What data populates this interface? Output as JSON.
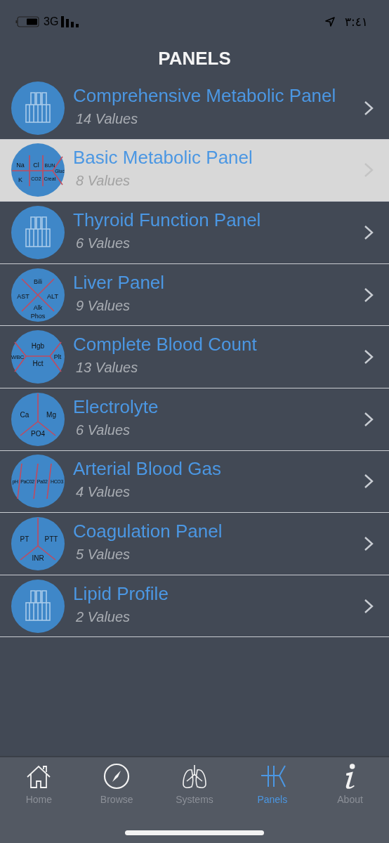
{
  "status_bar": {
    "network": "3G",
    "time": "٣:٤١"
  },
  "title": "PANELS",
  "panels": [
    {
      "name": "Comprehensive Metabolic Panel",
      "count": "14 Values",
      "selected": false,
      "icon": {
        "kind": "tubes"
      }
    },
    {
      "name": "Basic Metabolic Panel",
      "count": "8 Values",
      "selected": true,
      "icon": {
        "kind": "chem7",
        "labels": [
          "Na",
          "Cl",
          "BUN",
          "Gluc",
          "K",
          "CO2",
          "Creat"
        ]
      }
    },
    {
      "name": "Thyroid Function Panel",
      "count": "6 Values",
      "selected": false,
      "icon": {
        "kind": "tubes"
      }
    },
    {
      "name": "Liver Panel",
      "count": "9 Values",
      "selected": false,
      "icon": {
        "kind": "cross",
        "labels": [
          "Bili",
          "AST",
          "ALT",
          "Alk",
          "Phos"
        ]
      }
    },
    {
      "name": "Complete Blood Count",
      "count": "13 Values",
      "selected": false,
      "icon": {
        "kind": "fishbone",
        "labels": [
          "Hgb",
          "WBC",
          "Hct",
          "Plt"
        ]
      }
    },
    {
      "name": "Electrolyte",
      "count": "6 Values",
      "selected": false,
      "icon": {
        "kind": "fork",
        "labels": [
          "Ca",
          "Mg",
          "PO4"
        ]
      }
    },
    {
      "name": "Arterial Blood Gas",
      "count": "4 Values",
      "selected": false,
      "icon": {
        "kind": "slashes",
        "labels": [
          "pH",
          "PaC02",
          "Pa02",
          "HCO3"
        ]
      }
    },
    {
      "name": "Coagulation Panel",
      "count": "5 Values",
      "selected": false,
      "icon": {
        "kind": "fork",
        "labels": [
          "PT",
          "PTT",
          "INR"
        ]
      }
    },
    {
      "name": "Lipid Profile",
      "count": "2 Values",
      "selected": false,
      "icon": {
        "kind": "tubes"
      }
    }
  ],
  "tabs": [
    {
      "label": "Home",
      "selected": false
    },
    {
      "label": "Browse",
      "selected": false
    },
    {
      "label": "Systems",
      "selected": false
    },
    {
      "label": "Panels",
      "selected": true
    },
    {
      "label": "About",
      "selected": false
    }
  ]
}
